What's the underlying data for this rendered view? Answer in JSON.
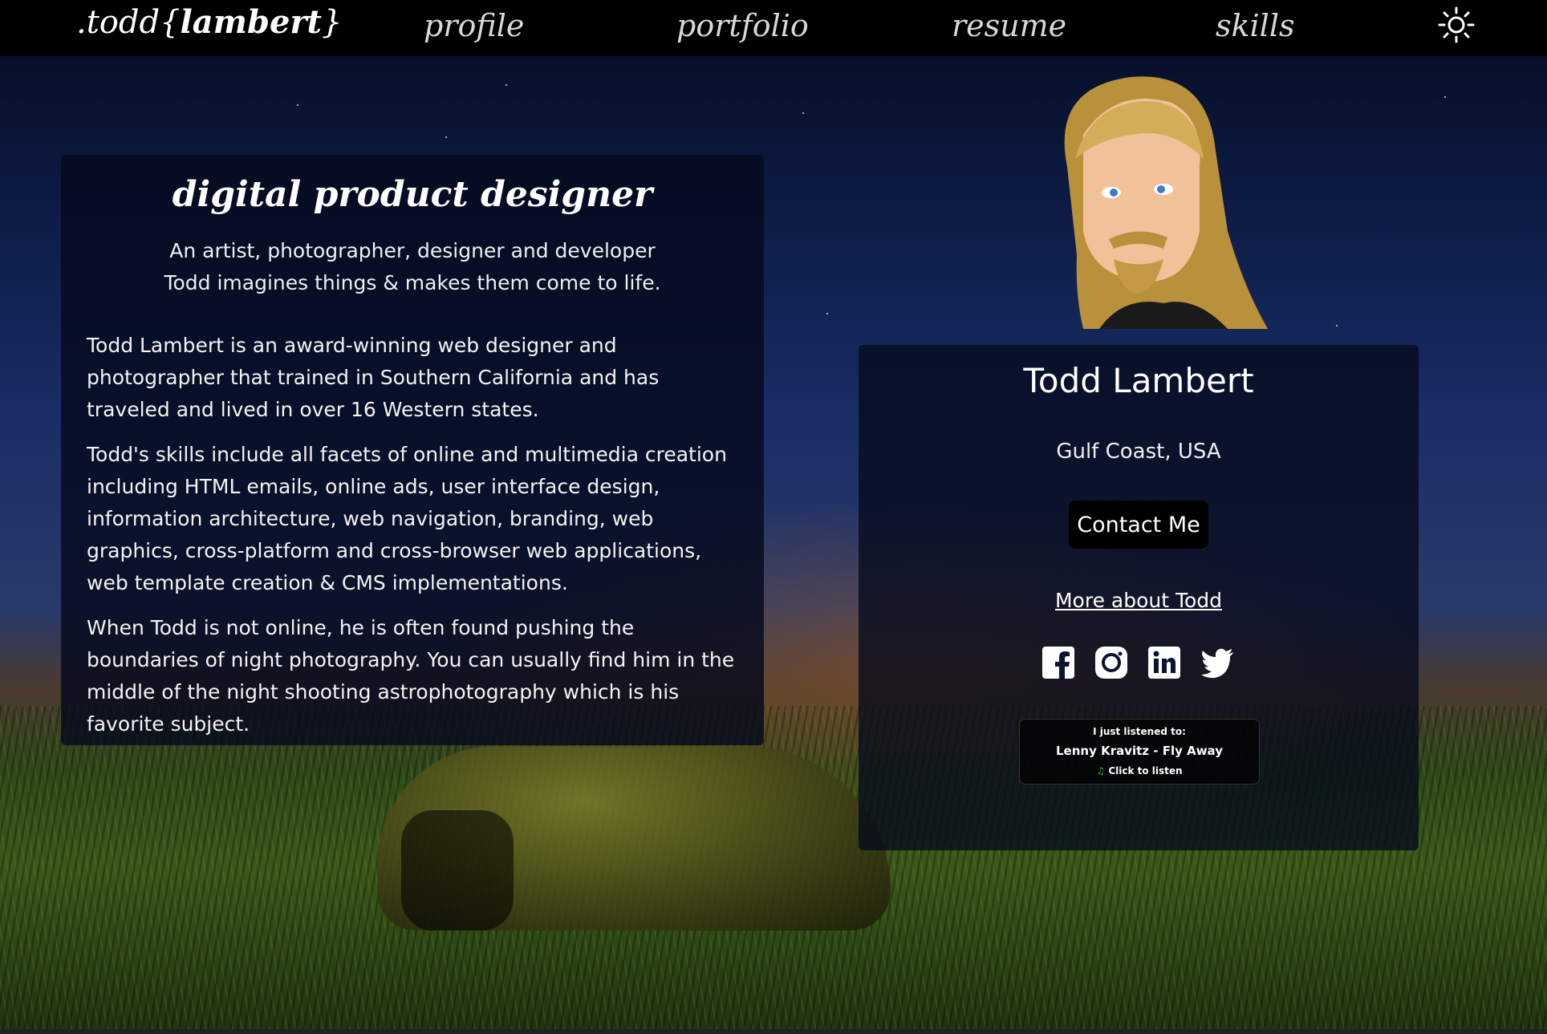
{
  "nav": {
    "logo_prefix": ".todd{",
    "logo_bold": "lambert",
    "logo_suffix": "}",
    "links": [
      "profile",
      "portfolio",
      "resume",
      "skills"
    ],
    "theme_icon": "sun-icon"
  },
  "intro": {
    "title": "digital product designer",
    "tagline_1": "An artist, photographer, designer and developer",
    "tagline_2": "Todd imagines things & makes them come to life.",
    "paragraphs": [
      "Todd Lambert is an award-winning web designer and photographer that trained in Southern California and has traveled and lived in over 16 Western states.",
      "Todd's skills include all facets of online and multimedia creation including HTML emails, online ads, user interface design, information architecture, web navigation, branding, web graphics, cross-platform and cross-browser web applications, web template creation & CMS implementations.",
      "When Todd is not online, he is often found pushing the boundaries of night photography. You can usually find him in the middle of the night shooting astrophotography which is his favorite subject."
    ]
  },
  "profile": {
    "name": "Todd Lambert",
    "location": "Gulf Coast, USA",
    "contact_label": "Contact Me",
    "more_label": "More about Todd",
    "socials": [
      "facebook-icon",
      "instagram-icon",
      "linkedin-icon",
      "twitter-icon"
    ]
  },
  "listening": {
    "heading": "I just listened to:",
    "track": "Lenny Kravitz - Fly Away",
    "cta": "Click to listen"
  },
  "colors": {
    "nav_bg": "#000000",
    "panel_bg": "#050a1c",
    "spotify_green": "#1DB954"
  }
}
